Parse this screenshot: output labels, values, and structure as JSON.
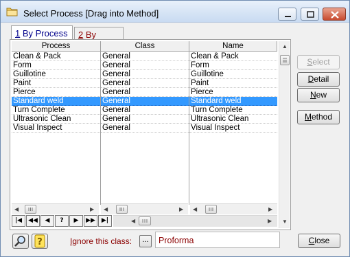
{
  "window": {
    "title": "Select Process [Drag into Method]",
    "icon": "folder-icon"
  },
  "tabs": [
    {
      "key": "1",
      "rest": " By Process",
      "active": true
    },
    {
      "key": "2",
      "rest": " By Class",
      "active": false
    }
  ],
  "table": {
    "columns": [
      "Process",
      "Class",
      "Name"
    ],
    "rows": [
      {
        "process": "Clean & Pack",
        "class": "General",
        "name": "Clean & Pack",
        "selected": false
      },
      {
        "process": "Form",
        "class": "General",
        "name": "Form",
        "selected": false
      },
      {
        "process": "Guillotine",
        "class": "General",
        "name": "Guillotine",
        "selected": false
      },
      {
        "process": "Paint",
        "class": "General",
        "name": "Paint",
        "selected": false
      },
      {
        "process": "Pierce",
        "class": "General",
        "name": "Pierce",
        "selected": false
      },
      {
        "process": "Standard weld",
        "class": "General",
        "name": "Standard weld",
        "selected": true
      },
      {
        "process": "Turn Complete",
        "class": "General",
        "name": "Turn Complete",
        "selected": false
      },
      {
        "process": "Ultrasonic Clean",
        "class": "General",
        "name": "Ultrasonic Clean",
        "selected": false
      },
      {
        "process": "Visual Inspect",
        "class": "General",
        "name": "Visual Inspect",
        "selected": false
      }
    ]
  },
  "navigator": {
    "buttons": [
      "|◀",
      "◀◀",
      "◀",
      "?",
      "▶",
      "▶▶",
      "▶|"
    ]
  },
  "side_buttons": {
    "select": {
      "key": "S",
      "rest": "elect",
      "enabled": false
    },
    "detail": {
      "key": "D",
      "rest": "etail",
      "enabled": true
    },
    "new": {
      "key": "N",
      "rest": "ew",
      "enabled": true
    },
    "method": {
      "key": "M",
      "rest": "ethod",
      "enabled": true
    }
  },
  "footer": {
    "ignore_key": "I",
    "ignore_rest": "gnore this class:",
    "dots": "...",
    "ignore_value": "Proforma",
    "close_key": "C",
    "close_rest": "lose"
  },
  "colors": {
    "selection": "#3399ff",
    "accent_text": "#8b0000",
    "active_tab_text": "#00008b"
  }
}
